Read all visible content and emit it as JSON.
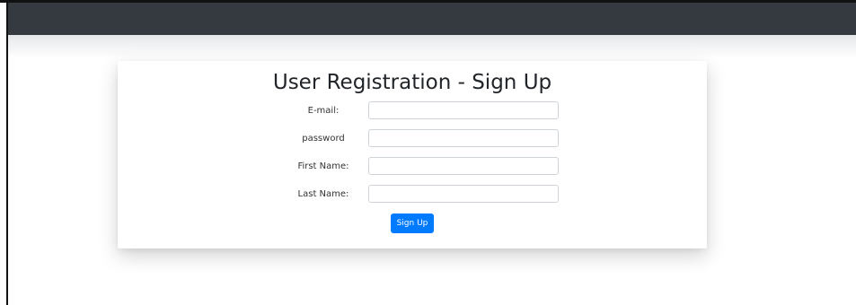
{
  "page": {
    "title": "User Registration - Sign Up"
  },
  "form": {
    "fields": [
      {
        "label": "E-mail:",
        "value": "",
        "placeholder": ""
      },
      {
        "label": "password",
        "value": "",
        "placeholder": ""
      },
      {
        "label": "First Name:",
        "value": "",
        "placeholder": ""
      },
      {
        "label": "Last Name:",
        "value": "",
        "placeholder": ""
      }
    ],
    "submit_label": "Sign Up"
  },
  "colors": {
    "navbar": "#343a40",
    "primary_button": "#007bff",
    "page_background": "#ffffff"
  }
}
